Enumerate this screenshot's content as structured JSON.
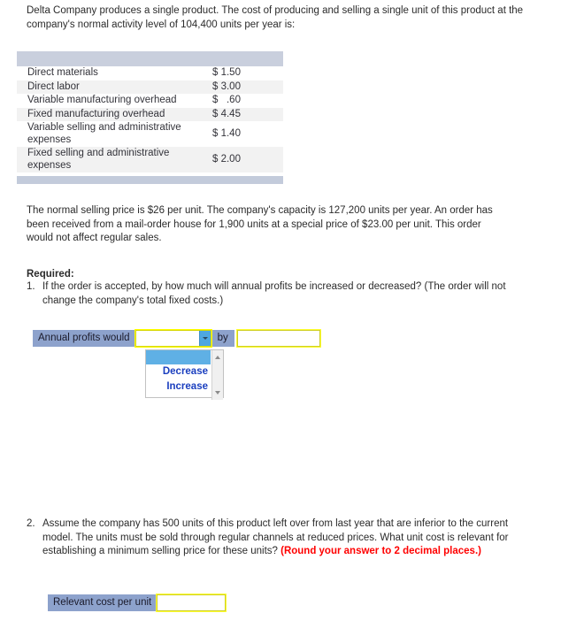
{
  "intro": {
    "paragraph": "Delta Company produces a single product. The cost of producing and selling a single unit of this product at the company's normal activity level of 104,400 units per year is:"
  },
  "cost_table": {
    "rows": [
      {
        "label": "Direct materials",
        "value": "$ 1.50"
      },
      {
        "label": "Direct labor",
        "value": "$ 3.00"
      },
      {
        "label": "Variable manufacturing overhead",
        "value": "$   .60"
      },
      {
        "label": "Fixed manufacturing overhead",
        "value": "$ 4.45"
      },
      {
        "label": "Variable selling and administrative expenses",
        "value": "$ 1.40"
      },
      {
        "label": "Fixed selling and administrative expenses",
        "value": "$ 2.00"
      }
    ]
  },
  "mid_paragraph": "The normal selling price is $26 per unit. The company's capacity is 127,200 units per year. An order has been received from a mail-order house for 1,900 units at a special price of $23.00 per unit. This order would not affect regular sales.",
  "required": {
    "heading": "Required:",
    "q1": {
      "number": "1.",
      "text": "If the order is accepted, by how much will annual profits be increased or decreased? (The order will not change the company's total fixed costs.)"
    },
    "q2": {
      "number": "2.",
      "text": "Assume the company has 500 units of this product left over from last year that are inferior to the current model. The units must be sold through regular channels at reduced prices. What unit cost is relevant for establishing a minimum selling price for these units? ",
      "emphasis": "(Round your answer to 2 decimal places.)"
    }
  },
  "answer1": {
    "label": "Annual profits would",
    "select_value": "",
    "connector_label": "by",
    "amount_value": "",
    "amount_placeholder": "",
    "dropdown_open": true,
    "dropdown_options": [
      "",
      "Decrease",
      "Increase"
    ],
    "selected_index": 0,
    "arrow_icon": "chevron-down-icon",
    "scrollbar_up_icon": "scroll-up-arrow-icon",
    "scrollbar_down_icon": "scroll-down-arrow-icon"
  },
  "answer2": {
    "label": "Relevant cost per unit",
    "value": "",
    "placeholder": ""
  },
  "colors": {
    "label_band": "#8da2cc",
    "table_header_band": "#c9cfdd",
    "table_footer_band": "#c3cbdb",
    "input_border_yellow": "#ffff33",
    "option_text_blue": "#1b3fbf",
    "highlight_blue": "#5fb0e5",
    "emphasis_red": "#ff0000"
  }
}
